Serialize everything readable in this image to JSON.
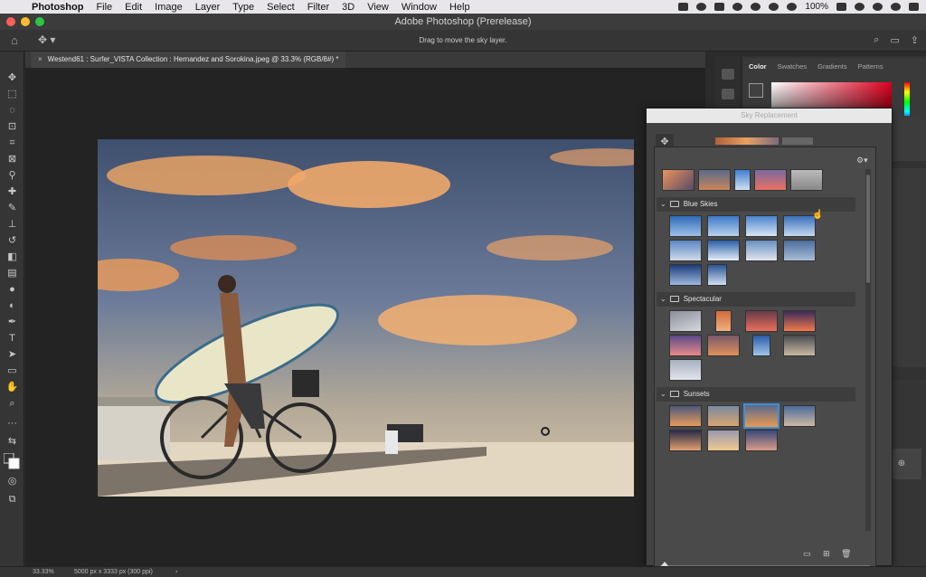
{
  "menubar": {
    "app": "Photoshop",
    "items": [
      "File",
      "Edit",
      "Image",
      "Layer",
      "Type",
      "Select",
      "Filter",
      "3D",
      "View",
      "Window",
      "Help"
    ],
    "battery": "100%"
  },
  "window": {
    "title": "Adobe Photoshop (Prerelease)"
  },
  "options": {
    "hint": "Drag to move the sky layer."
  },
  "document": {
    "tab_title": "Westend61 : Surfer_VISTA Collection : Hernandez and Sorokina.jpeg @ 33.3% (RGB/8#) *",
    "close": "×"
  },
  "status": {
    "zoom": "33.33%",
    "doc_info": "5000 px x 3333 px (300 ppi)",
    "arrow": "›"
  },
  "color_panel": {
    "tabs": [
      "Color",
      "Swatches",
      "Gradients",
      "Patterns"
    ],
    "active": "Color"
  },
  "sky_dialog": {
    "title": "Sky Replacement"
  },
  "sky_picker": {
    "folders": [
      {
        "name": "Blue Skies",
        "count": 10
      },
      {
        "name": "Spectacular",
        "count": 9
      },
      {
        "name": "Sunsets",
        "count": 7
      }
    ]
  },
  "colors": {
    "accent": "#3d8fd6",
    "panel": "#4a4a4a"
  }
}
